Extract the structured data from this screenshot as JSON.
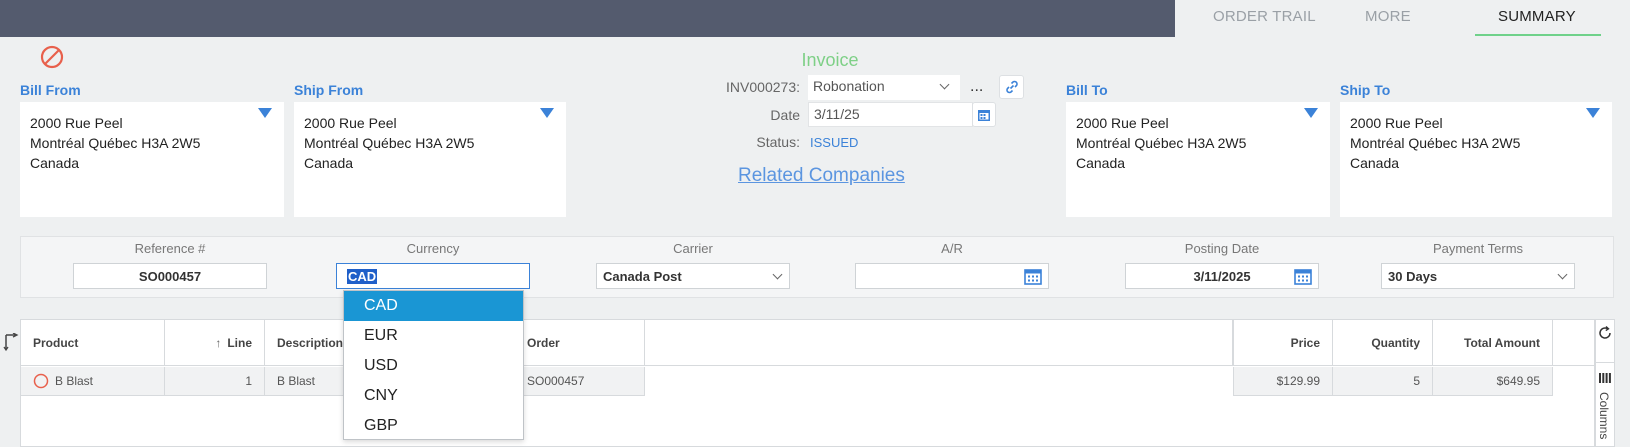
{
  "tabs": [
    {
      "label": "ORDER TRAIL",
      "active": false
    },
    {
      "label": "MORE",
      "active": false
    },
    {
      "label": "SUMMARY",
      "active": true
    }
  ],
  "invoice": {
    "title": "Invoice",
    "number_label": "INV000273:",
    "company": "Robonation",
    "more_label": "...",
    "date_label": "Date",
    "date": "3/11/25",
    "status_label": "Status:",
    "status": "ISSUED",
    "related_link": "Related Companies"
  },
  "addresses": {
    "bill_from": {
      "label": "Bill From",
      "line1": "2000 Rue Peel",
      "line2": "Montréal Québec H3A 2W5",
      "line3": "Canada"
    },
    "ship_from": {
      "label": "Ship From",
      "line1": "2000 Rue Peel",
      "line2": "Montréal Québec H3A 2W5",
      "line3": "Canada"
    },
    "bill_to": {
      "label": "Bill To",
      "line1": "2000 Rue Peel",
      "line2": "Montréal Québec H3A 2W5",
      "line3": "Canada"
    },
    "ship_to": {
      "label": "Ship To",
      "line1": "2000 Rue Peel",
      "line2": "Montréal Québec H3A 2W5",
      "line3": "Canada"
    }
  },
  "fields": {
    "reference": {
      "label": "Reference #",
      "value": "SO000457"
    },
    "currency": {
      "label": "Currency",
      "value": "CAD"
    },
    "carrier": {
      "label": "Carrier",
      "value": "Canada Post"
    },
    "ar": {
      "label": "A/R",
      "value": ""
    },
    "posting_date": {
      "label": "Posting Date",
      "value": "3/11/2025"
    },
    "payment_terms": {
      "label": "Payment Terms",
      "value": "30 Days"
    }
  },
  "currency_options": [
    "CAD",
    "EUR",
    "USD",
    "CNY",
    "GBP"
  ],
  "grid": {
    "headers": {
      "product": "Product",
      "line": "Line",
      "description": "Description",
      "order": "Order",
      "price": "Price",
      "quantity": "Quantity",
      "total": "Total Amount"
    },
    "rows": [
      {
        "product": "B Blast",
        "line": "1",
        "description": "B Blast",
        "order": "SO000457",
        "price": "$129.99",
        "quantity": "5",
        "total": "$649.95"
      }
    ],
    "columns_label": "Columns"
  },
  "colors": {
    "accent": "#3b82d8",
    "topbar": "#545b6e",
    "invoice_green": "#7ed087",
    "selection": "#1a96d4",
    "cancel_red": "#e8604c"
  }
}
